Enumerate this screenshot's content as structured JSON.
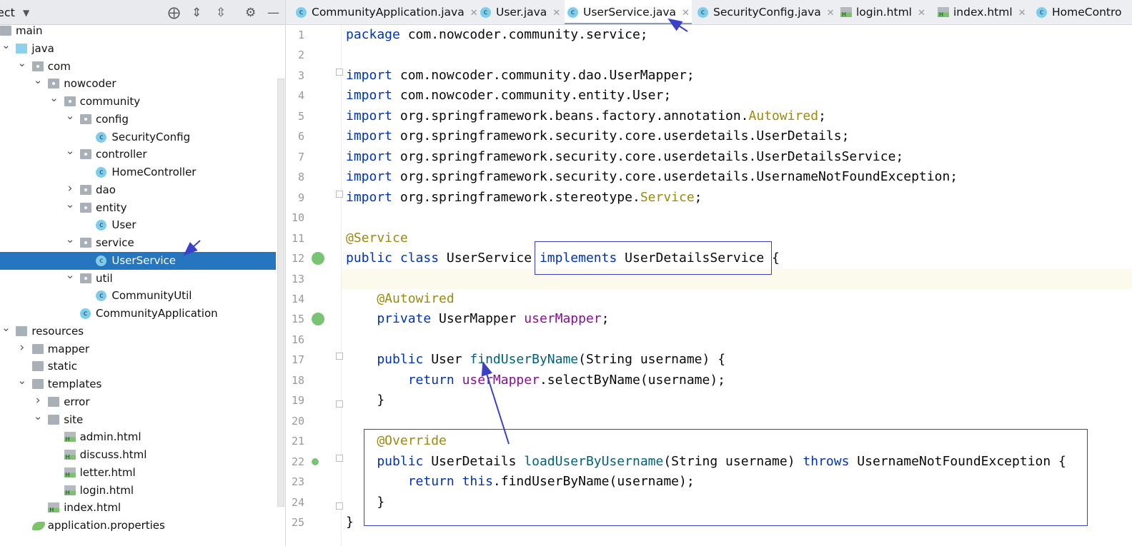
{
  "project_panel": {
    "title": "ect",
    "toolbar": [
      {
        "icon": "locate-icon",
        "glyph": "⨁"
      },
      {
        "icon": "expand-all-icon",
        "glyph": "⇕"
      },
      {
        "icon": "collapse-all-icon",
        "glyph": "⇳"
      },
      {
        "icon": "gear-icon",
        "glyph": "⚙"
      },
      {
        "icon": "minimize-icon",
        "glyph": "—"
      }
    ],
    "tree": [
      {
        "label": "main",
        "level": 0,
        "type": "folder",
        "chevron": "none"
      },
      {
        "label": "java",
        "level": 1,
        "type": "src",
        "chevron": "down"
      },
      {
        "label": "com",
        "level": 2,
        "type": "pkg",
        "chevron": "down"
      },
      {
        "label": "nowcoder",
        "level": 3,
        "type": "pkg",
        "chevron": "down"
      },
      {
        "label": "community",
        "level": 4,
        "type": "pkg",
        "chevron": "down"
      },
      {
        "label": "config",
        "level": 5,
        "type": "pkg",
        "chevron": "down"
      },
      {
        "label": "SecurityConfig",
        "level": 6,
        "type": "class",
        "chevron": "none"
      },
      {
        "label": "controller",
        "level": 5,
        "type": "pkg",
        "chevron": "down"
      },
      {
        "label": "HomeController",
        "level": 6,
        "type": "class",
        "chevron": "none"
      },
      {
        "label": "dao",
        "level": 5,
        "type": "pkg",
        "chevron": "right"
      },
      {
        "label": "entity",
        "level": 5,
        "type": "pkg",
        "chevron": "down"
      },
      {
        "label": "User",
        "level": 6,
        "type": "class",
        "chevron": "none"
      },
      {
        "label": "service",
        "level": 5,
        "type": "pkg",
        "chevron": "down"
      },
      {
        "label": "UserService",
        "level": 6,
        "type": "class",
        "chevron": "none",
        "selected": true
      },
      {
        "label": "util",
        "level": 5,
        "type": "pkg",
        "chevron": "down"
      },
      {
        "label": "CommunityUtil",
        "level": 6,
        "type": "class",
        "chevron": "none"
      },
      {
        "label": "CommunityApplication",
        "level": 5,
        "type": "class",
        "chevron": "none"
      },
      {
        "label": "resources",
        "level": 1,
        "type": "folder",
        "chevron": "down"
      },
      {
        "label": "mapper",
        "level": 2,
        "type": "folder",
        "chevron": "right"
      },
      {
        "label": "static",
        "level": 2,
        "type": "folder",
        "chevron": "none"
      },
      {
        "label": "templates",
        "level": 2,
        "type": "folder",
        "chevron": "down"
      },
      {
        "label": "error",
        "level": 3,
        "type": "folder",
        "chevron": "right"
      },
      {
        "label": "site",
        "level": 3,
        "type": "folder",
        "chevron": "down"
      },
      {
        "label": "admin.html",
        "level": 4,
        "type": "html",
        "chevron": "none"
      },
      {
        "label": "discuss.html",
        "level": 4,
        "type": "html",
        "chevron": "none"
      },
      {
        "label": "letter.html",
        "level": 4,
        "type": "html",
        "chevron": "none"
      },
      {
        "label": "login.html",
        "level": 4,
        "type": "html",
        "chevron": "none"
      },
      {
        "label": "index.html",
        "level": 3,
        "type": "html",
        "chevron": "none"
      },
      {
        "label": "application.properties",
        "level": 2,
        "type": "prop",
        "chevron": "none"
      }
    ]
  },
  "tabs": [
    {
      "label": "CommunityApplication.java",
      "type": "class"
    },
    {
      "label": "User.java",
      "type": "class"
    },
    {
      "label": "UserService.java",
      "type": "class",
      "active": true
    },
    {
      "label": "SecurityConfig.java",
      "type": "class"
    },
    {
      "label": "login.html",
      "type": "html"
    },
    {
      "label": "index.html",
      "type": "html"
    },
    {
      "label": "HomeContro",
      "type": "class"
    }
  ],
  "editor": {
    "highlighted_line": 13,
    "lines": [
      [
        [
          "package ",
          "kw"
        ],
        [
          "com.nowcoder.community.service;",
          ""
        ]
      ],
      [],
      [
        [
          "import ",
          "kw"
        ],
        [
          "com.nowcoder.community.dao.UserMapper;",
          ""
        ]
      ],
      [
        [
          "import ",
          "kw"
        ],
        [
          "com.nowcoder.community.entity.User;",
          ""
        ]
      ],
      [
        [
          "import ",
          "kw"
        ],
        [
          "org.springframework.beans.factory.annotation.",
          ""
        ],
        [
          "Autowired",
          "an"
        ],
        [
          ";",
          ""
        ]
      ],
      [
        [
          "import ",
          "kw"
        ],
        [
          "org.springframework.security.core.userdetails.UserDetails;",
          ""
        ]
      ],
      [
        [
          "import ",
          "kw"
        ],
        [
          "org.springframework.security.core.userdetails.UserDetailsService;",
          ""
        ]
      ],
      [
        [
          "import ",
          "kw"
        ],
        [
          "org.springframework.security.core.userdetails.UsernameNotFoundException;",
          ""
        ]
      ],
      [
        [
          "import ",
          "kw"
        ],
        [
          "org.springframework.stereotype.",
          ""
        ],
        [
          "Service",
          "an"
        ],
        [
          ";",
          ""
        ]
      ],
      [],
      [
        [
          "@Service",
          "an"
        ]
      ],
      [
        [
          "public class ",
          "kw"
        ],
        [
          "UserService ",
          ""
        ],
        [
          "implements ",
          "kw"
        ],
        [
          "UserDetailsService {",
          ""
        ]
      ],
      [],
      [
        [
          "    @Autowired",
          "an"
        ]
      ],
      [
        [
          "    private ",
          "kw"
        ],
        [
          "UserMapper ",
          ""
        ],
        [
          "userMapper",
          "fd"
        ],
        [
          ";",
          ""
        ]
      ],
      [],
      [
        [
          "    public ",
          "kw"
        ],
        [
          "User ",
          ""
        ],
        [
          "findUserByName",
          "md"
        ],
        [
          "(String username) {",
          ""
        ]
      ],
      [
        [
          "        return ",
          "kw"
        ],
        [
          "userMapper",
          "fd"
        ],
        [
          ".selectByName(username);",
          ""
        ]
      ],
      [
        [
          "    }",
          ""
        ]
      ],
      [],
      [
        [
          "    @Override",
          "an"
        ]
      ],
      [
        [
          "    public ",
          "kw"
        ],
        [
          "UserDetails ",
          ""
        ],
        [
          "loadUserByUsername",
          "md"
        ],
        [
          "(String username) ",
          ""
        ],
        [
          "throws ",
          "kw"
        ],
        [
          "UsernameNotFoundException {",
          ""
        ]
      ],
      [
        [
          "        return ",
          "kw"
        ],
        [
          "this",
          "kw"
        ],
        [
          ".findUserByName(username);",
          ""
        ]
      ],
      [
        [
          "    }",
          ""
        ]
      ],
      [
        [
          "}",
          ""
        ]
      ]
    ]
  },
  "annotation_color": "#3b40c8"
}
